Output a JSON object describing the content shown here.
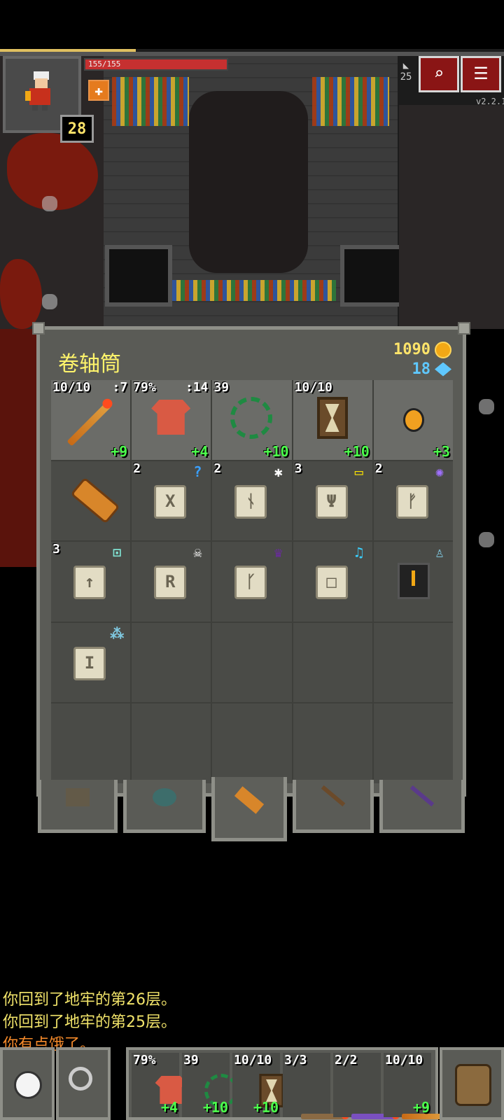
{
  "hud": {
    "hp_text": "155/155",
    "hp_fraction": 1.0,
    "xp_fraction": 0.27,
    "hero_level": "28",
    "depth": "25",
    "version": "v2.2.1"
  },
  "bag": {
    "title": "卷轴筒",
    "gold": "1090",
    "gems": "18",
    "slots": [
      {
        "icon": "fire-wand-icon",
        "tl": "10/10",
        "tr": ":7",
        "br": "+9",
        "equipped": true
      },
      {
        "icon": "red-armor-icon",
        "tl": "79%",
        "tr": ":14",
        "br": "+4",
        "equipped": true
      },
      {
        "icon": "green-whip-icon",
        "tl": "39",
        "tr": "",
        "br": "+10",
        "equipped": true
      },
      {
        "icon": "hourglass-icon",
        "tl": "10/10",
        "tr": "",
        "br": "+10",
        "equipped": true
      },
      {
        "icon": "orange-flask-ring-icon",
        "tl": "",
        "tr": "",
        "br": "+3",
        "equipped": true
      },
      {
        "icon": "scroll-holder-icon",
        "tl": "",
        "br": ""
      },
      {
        "icon": "scroll-icon",
        "tl": "2",
        "rune": "X",
        "mark": "?"
      },
      {
        "icon": "scroll-icon",
        "tl": "2",
        "rune": "ᚾ",
        "mark": "✱"
      },
      {
        "icon": "scroll-icon",
        "tl": "3",
        "rune": "Ψ",
        "mark": "▭"
      },
      {
        "icon": "scroll-icon",
        "tl": "2",
        "rune": "ᚠ",
        "mark": "✺"
      },
      {
        "icon": "scroll-icon",
        "tl": "3",
        "rune": "↑",
        "mark": "⊡"
      },
      {
        "icon": "scroll-icon",
        "tl": "",
        "rune": "R",
        "mark": "☠"
      },
      {
        "icon": "scroll-icon",
        "tl": "",
        "rune": "ᚴ",
        "mark": "♛"
      },
      {
        "icon": "scroll-icon",
        "tl": "",
        "rune": "□",
        "mark": "♫"
      },
      {
        "icon": "top-hat-icon",
        "tl": "",
        "rune": "",
        "mark": "♙"
      },
      {
        "icon": "scroll-icon",
        "tl": "",
        "rune": "I",
        "mark": "⁂"
      }
    ]
  },
  "log": [
    {
      "text": "你回到了地牢的第26层。",
      "color": "#f2e46a"
    },
    {
      "text": "你回到了地牢的第25层。",
      "color": "#f2e46a"
    },
    {
      "text": "你有点饿了。",
      "color": "#f58a2a"
    }
  ],
  "quickslots": [
    {
      "icon": "red-armor-icon",
      "tl": "79%",
      "br": "+4"
    },
    {
      "icon": "green-whip-icon",
      "tl": "39",
      "br": "+10"
    },
    {
      "icon": "hourglass-icon",
      "tl": "10/10",
      "br": "+10"
    },
    {
      "icon": "staff-icon",
      "tl": "3/3",
      "br": ""
    },
    {
      "icon": "purple-wand-icon",
      "tl": "2/2",
      "br": ""
    },
    {
      "icon": "fire-wand-icon",
      "tl": "10/10",
      "br": "+9"
    }
  ],
  "colors": {
    "gold": "#ffe46a",
    "gem": "#5fc8ff",
    "bonus": "#4cff4c",
    "accent": "#8a1515"
  }
}
